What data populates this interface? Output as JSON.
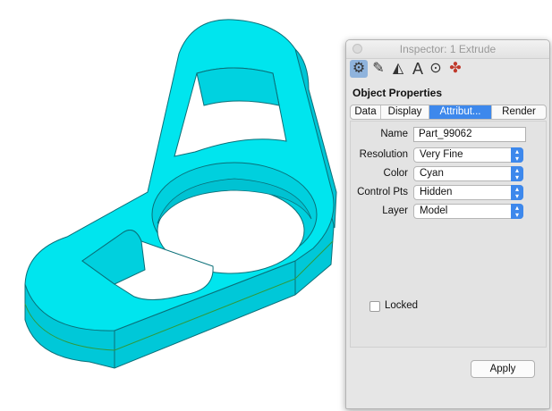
{
  "viewport": {
    "part_color": "#00e5ee"
  },
  "inspector": {
    "title": "Inspector: 1 Extrude",
    "toolbar_icons": [
      "object-properties-icon",
      "pencil-icon",
      "paint-icon",
      "text-icon",
      "dimension-icon",
      "render-icon"
    ],
    "section_title": "Object Properties",
    "tabs": [
      "Data",
      "Display",
      "Attribut...",
      "Render"
    ],
    "active_tab": "Attribut...",
    "fields": {
      "name_label": "Name",
      "name_value": "Part_99062",
      "resolution_label": "Resolution",
      "resolution_value": "Very Fine",
      "color_label": "Color",
      "color_value": "Cyan",
      "control_pts_label": "Control Pts",
      "control_pts_value": "Hidden",
      "layer_label": "Layer",
      "layer_value": "Model"
    },
    "locked_label": "Locked",
    "locked_checked": false,
    "apply_label": "Apply",
    "accent_color": "#3d88ec"
  }
}
